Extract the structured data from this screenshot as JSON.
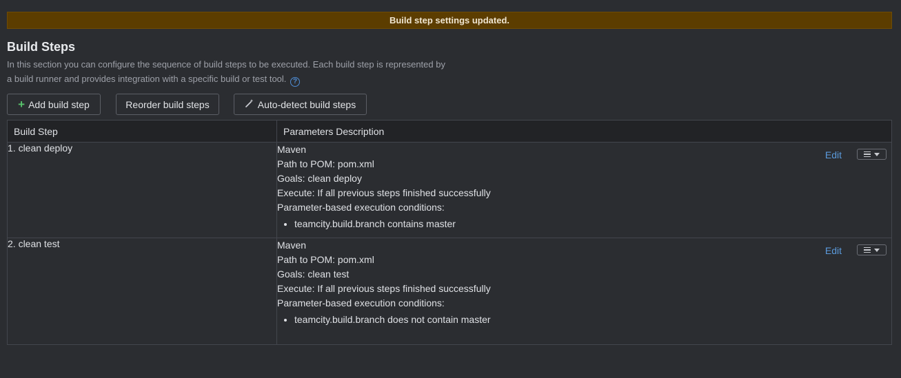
{
  "banner": {
    "message": "Build step settings updated."
  },
  "section": {
    "title": "Build Steps",
    "description": "In this section you can configure the sequence of build steps to be executed. Each build step is represented by a build runner and provides integration with a specific build or test tool."
  },
  "toolbar": {
    "add_label": "Add build step",
    "reorder_label": "Reorder build steps",
    "autodetect_label": "Auto-detect build steps"
  },
  "table": {
    "headers": [
      "Build Step",
      "Parameters Description"
    ],
    "edit_label": "Edit",
    "rows": [
      {
        "name": "1. clean deploy",
        "runner": "Maven",
        "pom": "Path to POM: pom.xml",
        "goals": "Goals: clean deploy",
        "execute": "Execute: If all previous steps finished successfully",
        "conditions_label": "Parameter-based execution conditions:",
        "condition": "teamcity.build.branch contains master"
      },
      {
        "name": "2. clean test",
        "runner": "Maven",
        "pom": "Path to POM: pom.xml",
        "goals": "Goals: clean test",
        "execute": "Execute: If all previous steps finished successfully",
        "conditions_label": "Parameter-based execution conditions:",
        "condition": "teamcity.build.branch does not contain master"
      }
    ]
  },
  "icons": {
    "add": "plus-icon",
    "autodetect": "magic-wand-icon",
    "help": "question-circle-icon",
    "row_menu": "list-menu-icon"
  },
  "colors": {
    "background": "#2b2d31",
    "banner": "#5c3d00",
    "link": "#5b9bdd",
    "add_icon": "#57c26b"
  }
}
